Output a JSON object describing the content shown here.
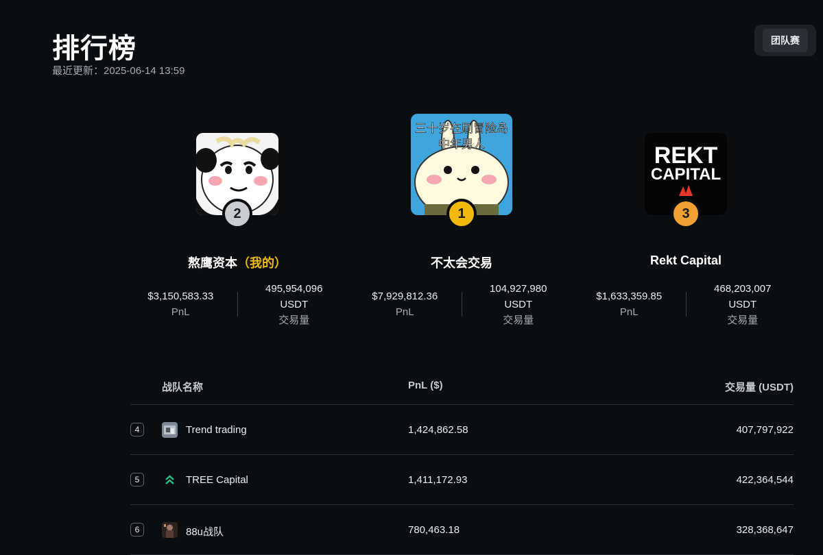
{
  "header": {
    "title": "排行榜",
    "updated": "最近更新：2025-06-14 13:59",
    "team_button": "团队赛"
  },
  "podium": [
    {
      "rank": "2",
      "name": "熬鹰资本",
      "mine_tag": "（我的）",
      "pnl": "$3,150,583.33",
      "pnl_label": "PnL",
      "volume": "495,954,096",
      "volume_unit": "USDT",
      "volume_label": "交易量",
      "avatar": "panda-meme-avatar"
    },
    {
      "rank": "1",
      "name": "不太会交易",
      "avatar_text_1": "三十岁在刷冒险岛",
      "avatar_text_2": "中年男人",
      "pnl": "$7,929,812.36",
      "pnl_label": "PnL",
      "volume": "104,927,980",
      "volume_unit": "USDT",
      "volume_label": "交易量",
      "avatar": "bunny-meme-avatar"
    },
    {
      "rank": "3",
      "name": "Rekt Capital",
      "avatar_text_1": "REKT",
      "avatar_text_2": "CAPITAL",
      "pnl": "$1,633,359.85",
      "pnl_label": "PnL",
      "volume": "468,203,007",
      "volume_unit": "USDT",
      "volume_label": "交易量",
      "avatar": "rekt-capital-logo"
    }
  ],
  "table": {
    "columns": [
      "战队名称",
      "PnL ($)",
      "交易量 (USDT)"
    ],
    "rows": [
      {
        "rank": "4",
        "name": "Trend trading",
        "pnl": "1,424,862.58",
        "volume": "407,797,922",
        "avatar": "photo-avatar"
      },
      {
        "rank": "5",
        "name": "TREE Capital",
        "pnl": "1,411,172.93",
        "volume": "422,364,544",
        "avatar": "green-chevron-logo"
      },
      {
        "rank": "6",
        "name": "88u战队",
        "pnl": "780,463.18",
        "volume": "328,368,647",
        "avatar": "character-avatar"
      }
    ]
  },
  "colors": {
    "background": "#0b0e11",
    "accent_gold": "#f0b90b",
    "silver": "#c9ccd1",
    "bronze": "#f0a030"
  }
}
